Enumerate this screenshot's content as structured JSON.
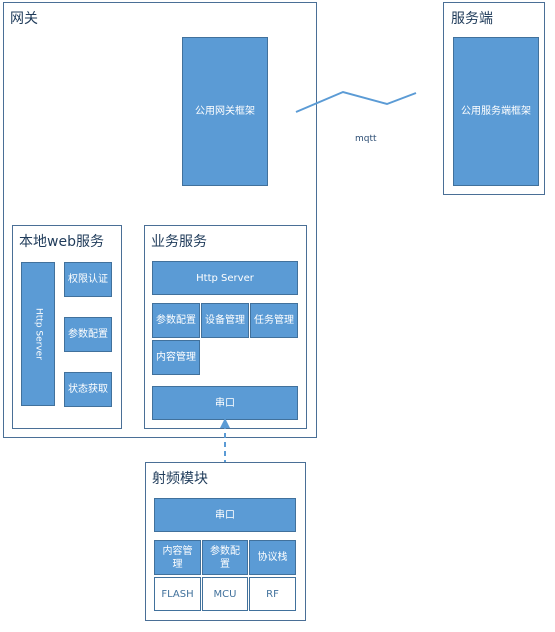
{
  "gateway": {
    "title": "网关",
    "framework": "公用网关框架",
    "local_web": {
      "title": "本地web服务",
      "http_server": "Http Server",
      "auth": "权限认证",
      "param_config": "参数配置",
      "status_get": "状态获取"
    },
    "business": {
      "title": "业务服务",
      "http_server": "Http Server",
      "param_config": "参数配置",
      "device_mgmt": "设备管理",
      "task_mgmt": "任务管理",
      "content_mgmt": "内容管理",
      "serial": "串口"
    }
  },
  "server": {
    "title": "服务端",
    "framework": "公用服务端框架"
  },
  "link_label": "mqtt",
  "rf_module": {
    "title": "射频模块",
    "serial": "串口",
    "content_mgmt": "内容管理",
    "param_config": "参数配置",
    "protocol_stack": "协议栈",
    "flash": "FLASH",
    "mcu": "MCU",
    "rf": "RF"
  },
  "colors": {
    "box_fill": "#5b9bd5",
    "box_border": "#41719c",
    "frame_border": "#4a6f96"
  }
}
